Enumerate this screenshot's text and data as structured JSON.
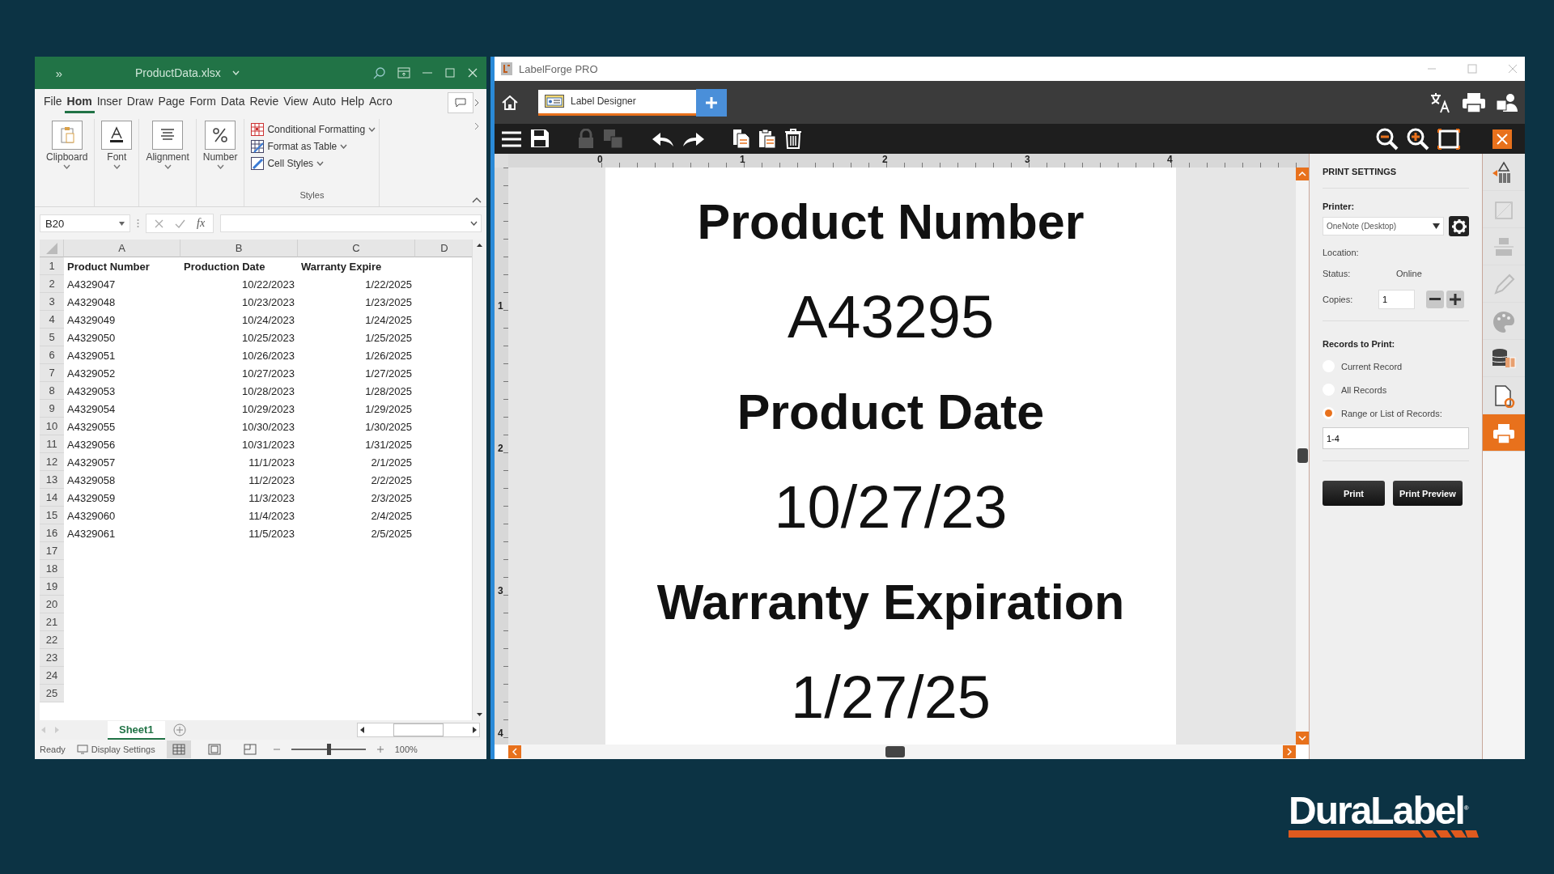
{
  "excel": {
    "quick_access": "»",
    "title": "ProductData.xlsx",
    "tabs": [
      {
        "label": "File",
        "selected": false
      },
      {
        "label": "Hom",
        "selected": true
      },
      {
        "label": "Inser",
        "selected": false
      },
      {
        "label": "Draw",
        "selected": false
      },
      {
        "label": "Page",
        "selected": false
      },
      {
        "label": "Form",
        "selected": false
      },
      {
        "label": "Data",
        "selected": false
      },
      {
        "label": "Revie",
        "selected": false
      },
      {
        "label": "View",
        "selected": false
      },
      {
        "label": "Auto",
        "selected": false
      },
      {
        "label": "Help",
        "selected": false
      },
      {
        "label": "Acro",
        "selected": false
      }
    ],
    "ribbon_groups": [
      {
        "label": "Clipboard",
        "kind": "clipboard"
      },
      {
        "label": "Font",
        "kind": "font"
      },
      {
        "label": "Alignment",
        "kind": "alignment"
      },
      {
        "label": "Number",
        "kind": "number"
      }
    ],
    "styles_group": {
      "label": "Styles",
      "items": [
        {
          "label": "Conditional Formatting",
          "kind": "conditional"
        },
        {
          "label": "Format as Table",
          "kind": "table"
        },
        {
          "label": "Cell Styles",
          "kind": "cell"
        }
      ]
    },
    "name_box": "B20",
    "function_label": "fx",
    "columns": [
      "A",
      "B",
      "C",
      "D"
    ],
    "rows": [
      {
        "number": "1",
        "kind": "header",
        "cells": [
          "Product Number",
          "Production Date",
          "Warranty Expire"
        ]
      },
      {
        "number": "2",
        "kind": "data",
        "cells": [
          "A4329047",
          "10/22/2023",
          "1/22/2025"
        ]
      },
      {
        "number": "3",
        "kind": "data",
        "cells": [
          "A4329048",
          "10/23/2023",
          "1/23/2025"
        ]
      },
      {
        "number": "4",
        "kind": "data",
        "cells": [
          "A4329049",
          "10/24/2023",
          "1/24/2025"
        ]
      },
      {
        "number": "5",
        "kind": "data",
        "cells": [
          "A4329050",
          "10/25/2023",
          "1/25/2025"
        ]
      },
      {
        "number": "6",
        "kind": "data",
        "cells": [
          "A4329051",
          "10/26/2023",
          "1/26/2025"
        ]
      },
      {
        "number": "7",
        "kind": "data",
        "cells": [
          "A4329052",
          "10/27/2023",
          "1/27/2025"
        ]
      },
      {
        "number": "8",
        "kind": "data",
        "cells": [
          "A4329053",
          "10/28/2023",
          "1/28/2025"
        ]
      },
      {
        "number": "9",
        "kind": "data",
        "cells": [
          "A4329054",
          "10/29/2023",
          "1/29/2025"
        ]
      },
      {
        "number": "10",
        "kind": "data",
        "cells": [
          "A4329055",
          "10/30/2023",
          "1/30/2025"
        ]
      },
      {
        "number": "11",
        "kind": "data",
        "cells": [
          "A4329056",
          "10/31/2023",
          "1/31/2025"
        ]
      },
      {
        "number": "12",
        "kind": "data",
        "cells": [
          "A4329057",
          "11/1/2023",
          "2/1/2025"
        ]
      },
      {
        "number": "13",
        "kind": "data",
        "cells": [
          "A4329058",
          "11/2/2023",
          "2/2/2025"
        ]
      },
      {
        "number": "14",
        "kind": "data",
        "cells": [
          "A4329059",
          "11/3/2023",
          "2/3/2025"
        ]
      },
      {
        "number": "15",
        "kind": "data",
        "cells": [
          "A4329060",
          "11/4/2023",
          "2/4/2025"
        ]
      },
      {
        "number": "16",
        "kind": "data",
        "cells": [
          "A4329061",
          "11/5/2023",
          "2/5/2025"
        ]
      },
      {
        "number": "17",
        "kind": "data"
      },
      {
        "number": "18",
        "kind": "data"
      },
      {
        "number": "19",
        "kind": "data"
      },
      {
        "number": "20",
        "kind": "data"
      },
      {
        "number": "21",
        "kind": "data"
      },
      {
        "number": "22",
        "kind": "data"
      },
      {
        "number": "23",
        "kind": "data"
      },
      {
        "number": "24",
        "kind": "data"
      },
      {
        "number": "25",
        "kind": "data"
      }
    ],
    "sheets": [
      {
        "label": "Sheet1",
        "selected": true
      }
    ],
    "status": "Ready",
    "display_settings": "Display Settings",
    "views": [
      {
        "kind": "normal",
        "selected": true
      },
      {
        "kind": "page_layout",
        "selected": false
      },
      {
        "kind": "page_break",
        "selected": false
      }
    ],
    "zoom": {
      "level": 0.5,
      "reading": "100%"
    }
  },
  "labelforge": {
    "title": "LabelForge PRO",
    "tab": {
      "label": "Label Designer",
      "selected": true
    },
    "tools": [
      {
        "kind": "menu",
        "disabled": false
      },
      {
        "kind": "save",
        "disabled": false
      },
      {
        "kind": "lock",
        "disabled": true
      },
      {
        "kind": "group",
        "disabled": true
      },
      {
        "kind": "undo",
        "disabled": false
      },
      {
        "kind": "redo",
        "disabled": false
      },
      {
        "kind": "copy",
        "disabled": false
      },
      {
        "kind": "paste",
        "disabled": false
      },
      {
        "kind": "delete",
        "disabled": false
      }
    ],
    "ruler_h": [
      "0",
      "1",
      "2",
      "3",
      "4"
    ],
    "ruler_v": [
      "1",
      "2",
      "3",
      "4"
    ],
    "label_lines": [
      {
        "text": "Product Number",
        "kind": "field_name"
      },
      {
        "text": "A43295",
        "kind": "field_value"
      },
      {
        "text": "Product Date",
        "kind": "field_name"
      },
      {
        "text": "10/27/23",
        "kind": "field_value"
      },
      {
        "text": "Warranty Expiration",
        "kind": "field_name"
      },
      {
        "text": "1/27/25",
        "kind": "field_value"
      }
    ],
    "print_settings": {
      "title": "PRINT SETTINGS",
      "printer_label": "Printer:",
      "printer": "OneNote (Desktop)",
      "location_label": "Location:",
      "status_label": "Status:",
      "status_value": "Online",
      "copies_label": "Copies:",
      "copies": "1",
      "records_label": "Records to Print:",
      "record_options": [
        {
          "label": "Current Record",
          "selected": false
        },
        {
          "label": "All Records",
          "selected": false
        },
        {
          "label": "Range or List of Records:",
          "selected": true
        }
      ],
      "range": "1-4",
      "buttons": [
        "Print",
        "Print Preview"
      ]
    },
    "side_tabs": [
      {
        "kind": "barcode",
        "selected": false
      },
      {
        "kind": "shape",
        "selected": false
      },
      {
        "kind": "align",
        "selected": false
      },
      {
        "kind": "pencil",
        "selected": false
      },
      {
        "kind": "palette",
        "selected": false
      },
      {
        "kind": "database",
        "selected": false
      },
      {
        "kind": "document",
        "selected": false
      },
      {
        "kind": "print",
        "selected": true
      }
    ]
  },
  "brand_logo": {
    "text": "DuraLabel",
    "mark": "®"
  }
}
